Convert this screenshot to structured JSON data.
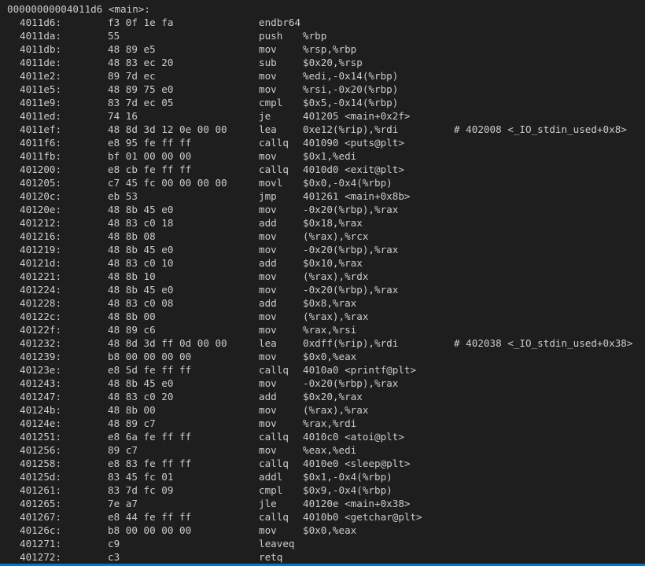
{
  "header": "00000000004011d6 <main>:",
  "rows": [
    {
      "addr": "4011d6:",
      "bytes": "f3 0f 1e fa",
      "mnemonic": "endbr64",
      "operands": "",
      "comment": ""
    },
    {
      "addr": "4011da:",
      "bytes": "55",
      "mnemonic": "push",
      "operands": "%rbp",
      "comment": ""
    },
    {
      "addr": "4011db:",
      "bytes": "48 89 e5",
      "mnemonic": "mov",
      "operands": "%rsp,%rbp",
      "comment": ""
    },
    {
      "addr": "4011de:",
      "bytes": "48 83 ec 20",
      "mnemonic": "sub",
      "operands": "$0x20,%rsp",
      "comment": ""
    },
    {
      "addr": "4011e2:",
      "bytes": "89 7d ec",
      "mnemonic": "mov",
      "operands": "%edi,-0x14(%rbp)",
      "comment": ""
    },
    {
      "addr": "4011e5:",
      "bytes": "48 89 75 e0",
      "mnemonic": "mov",
      "operands": "%rsi,-0x20(%rbp)",
      "comment": ""
    },
    {
      "addr": "4011e9:",
      "bytes": "83 7d ec 05",
      "mnemonic": "cmpl",
      "operands": "$0x5,-0x14(%rbp)",
      "comment": ""
    },
    {
      "addr": "4011ed:",
      "bytes": "74 16",
      "mnemonic": "je",
      "operands": "401205 <main+0x2f>",
      "comment": ""
    },
    {
      "addr": "4011ef:",
      "bytes": "48 8d 3d 12 0e 00 00",
      "mnemonic": "lea",
      "operands": "0xe12(%rip),%rdi",
      "comment": "# 402008 <_IO_stdin_used+0x8>"
    },
    {
      "addr": "4011f6:",
      "bytes": "e8 95 fe ff ff",
      "mnemonic": "callq",
      "operands": "401090 <puts@plt>",
      "comment": ""
    },
    {
      "addr": "4011fb:",
      "bytes": "bf 01 00 00 00",
      "mnemonic": "mov",
      "operands": "$0x1,%edi",
      "comment": ""
    },
    {
      "addr": "401200:",
      "bytes": "e8 cb fe ff ff",
      "mnemonic": "callq",
      "operands": "4010d0 <exit@plt>",
      "comment": ""
    },
    {
      "addr": "401205:",
      "bytes": "c7 45 fc 00 00 00 00",
      "mnemonic": "movl",
      "operands": "$0x0,-0x4(%rbp)",
      "comment": ""
    },
    {
      "addr": "40120c:",
      "bytes": "eb 53",
      "mnemonic": "jmp",
      "operands": "401261 <main+0x8b>",
      "comment": ""
    },
    {
      "addr": "40120e:",
      "bytes": "48 8b 45 e0",
      "mnemonic": "mov",
      "operands": "-0x20(%rbp),%rax",
      "comment": ""
    },
    {
      "addr": "401212:",
      "bytes": "48 83 c0 18",
      "mnemonic": "add",
      "operands": "$0x18,%rax",
      "comment": ""
    },
    {
      "addr": "401216:",
      "bytes": "48 8b 08",
      "mnemonic": "mov",
      "operands": "(%rax),%rcx",
      "comment": ""
    },
    {
      "addr": "401219:",
      "bytes": "48 8b 45 e0",
      "mnemonic": "mov",
      "operands": "-0x20(%rbp),%rax",
      "comment": ""
    },
    {
      "addr": "40121d:",
      "bytes": "48 83 c0 10",
      "mnemonic": "add",
      "operands": "$0x10,%rax",
      "comment": ""
    },
    {
      "addr": "401221:",
      "bytes": "48 8b 10",
      "mnemonic": "mov",
      "operands": "(%rax),%rdx",
      "comment": ""
    },
    {
      "addr": "401224:",
      "bytes": "48 8b 45 e0",
      "mnemonic": "mov",
      "operands": "-0x20(%rbp),%rax",
      "comment": ""
    },
    {
      "addr": "401228:",
      "bytes": "48 83 c0 08",
      "mnemonic": "add",
      "operands": "$0x8,%rax",
      "comment": ""
    },
    {
      "addr": "40122c:",
      "bytes": "48 8b 00",
      "mnemonic": "mov",
      "operands": "(%rax),%rax",
      "comment": ""
    },
    {
      "addr": "40122f:",
      "bytes": "48 89 c6",
      "mnemonic": "mov",
      "operands": "%rax,%rsi",
      "comment": ""
    },
    {
      "addr": "401232:",
      "bytes": "48 8d 3d ff 0d 00 00",
      "mnemonic": "lea",
      "operands": "0xdff(%rip),%rdi",
      "comment": "# 402038 <_IO_stdin_used+0x38>"
    },
    {
      "addr": "401239:",
      "bytes": "b8 00 00 00 00",
      "mnemonic": "mov",
      "operands": "$0x0,%eax",
      "comment": ""
    },
    {
      "addr": "40123e:",
      "bytes": "e8 5d fe ff ff",
      "mnemonic": "callq",
      "operands": "4010a0 <printf@plt>",
      "comment": ""
    },
    {
      "addr": "401243:",
      "bytes": "48 8b 45 e0",
      "mnemonic": "mov",
      "operands": "-0x20(%rbp),%rax",
      "comment": ""
    },
    {
      "addr": "401247:",
      "bytes": "48 83 c0 20",
      "mnemonic": "add",
      "operands": "$0x20,%rax",
      "comment": ""
    },
    {
      "addr": "40124b:",
      "bytes": "48 8b 00",
      "mnemonic": "mov",
      "operands": "(%rax),%rax",
      "comment": ""
    },
    {
      "addr": "40124e:",
      "bytes": "48 89 c7",
      "mnemonic": "mov",
      "operands": "%rax,%rdi",
      "comment": ""
    },
    {
      "addr": "401251:",
      "bytes": "e8 6a fe ff ff",
      "mnemonic": "callq",
      "operands": "4010c0 <atoi@plt>",
      "comment": ""
    },
    {
      "addr": "401256:",
      "bytes": "89 c7",
      "mnemonic": "mov",
      "operands": "%eax,%edi",
      "comment": ""
    },
    {
      "addr": "401258:",
      "bytes": "e8 83 fe ff ff",
      "mnemonic": "callq",
      "operands": "4010e0 <sleep@plt>",
      "comment": ""
    },
    {
      "addr": "40125d:",
      "bytes": "83 45 fc 01",
      "mnemonic": "addl",
      "operands": "$0x1,-0x4(%rbp)",
      "comment": ""
    },
    {
      "addr": "401261:",
      "bytes": "83 7d fc 09",
      "mnemonic": "cmpl",
      "operands": "$0x9,-0x4(%rbp)",
      "comment": ""
    },
    {
      "addr": "401265:",
      "bytes": "7e a7",
      "mnemonic": "jle",
      "operands": "40120e <main+0x38>",
      "comment": ""
    },
    {
      "addr": "401267:",
      "bytes": "e8 44 fe ff ff",
      "mnemonic": "callq",
      "operands": "4010b0 <getchar@plt>",
      "comment": ""
    },
    {
      "addr": "40126c:",
      "bytes": "b8 00 00 00 00",
      "mnemonic": "mov",
      "operands": "$0x0,%eax",
      "comment": ""
    },
    {
      "addr": "401271:",
      "bytes": "c9",
      "mnemonic": "leaveq",
      "operands": "",
      "comment": ""
    },
    {
      "addr": "401272:",
      "bytes": "c3",
      "mnemonic": "retq",
      "operands": "",
      "comment": ""
    }
  ],
  "colors": {
    "background": "#1e1e1e",
    "text": "#cccccc",
    "status_bar": "#007acc"
  }
}
